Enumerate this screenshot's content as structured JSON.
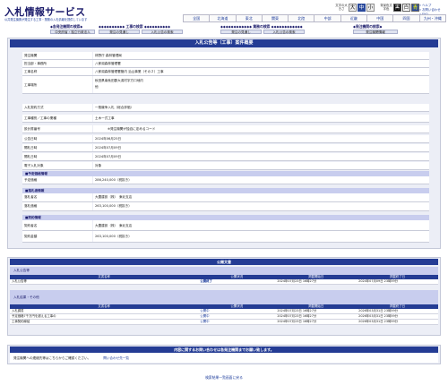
{
  "header": {
    "title": "入札情報サービス",
    "subtitle": "公共発注機関が発注する工事・業務の入札情報を提供しています",
    "font_size_label": "文字の大きさ",
    "font_sizes": [
      "大",
      "中",
      "小"
    ],
    "color_label": "背景色文字色",
    "color_options": [
      "黒",
      "白",
      "青"
    ],
    "help_links": [
      "ヘルプ",
      "お問い合わせ",
      "FAQ"
    ]
  },
  "region_tabs": [
    "全国",
    "北海道",
    "東北",
    "関東",
    "北陸",
    "中部",
    "近畿",
    "中国",
    "四国",
    "九州・沖縄"
  ],
  "categories": [
    {
      "title": "◆各発注機関の検索◆",
      "subs": [
        "中央府省・独立行政法人"
      ]
    },
    {
      "title": "◆◆◆◆◆◆◆◆◆◆ 工事の検索 ◆◆◆◆◆◆◆◆◆◆",
      "subs": [
        "発注の見通し",
        "入札公告の検索"
      ]
    },
    {
      "title": "◆◆◆◆◆◆◆◆◆◆◆◆ 業務の検索 ◆◆◆◆◆◆◆◆◆◆◆◆",
      "subs": [
        "発注の見通し",
        "入札公告の検索"
      ]
    },
    {
      "title": "◆発注機関の検索◆",
      "subs": [
        "発注機関情報"
      ]
    }
  ],
  "panel": {
    "title": "入札公告等（工事）案件概要",
    "rows": [
      {
        "label": "発注機関",
        "value": "林野庁 森林管理局"
      },
      {
        "label": "担当部・事務所",
        "value": "八郎潟森林管理署"
      },
      {
        "label": "工事名称",
        "value": "八郎潟森林管理署管内 治山事業（その２）工事"
      },
      {
        "label": "工事場所",
        "lines": [
          "秋田県南秋田郡大潟村字方口地内",
          "他"
        ]
      },
      {
        "label": "入札契約方式",
        "value": "一般競争入札（総合評価）"
      },
      {
        "label": "工事種別／工事の業種",
        "value": "土木一式工事"
      },
      {
        "label": "設計書番号",
        "value": "※発注機関が独自に定めるコード"
      },
      {
        "label": "公告日時",
        "value": "2024年06月25日"
      },
      {
        "label": "開札日時",
        "value": "2024年07月09日"
      },
      {
        "label": "開札日時",
        "value": "2024年07月09日"
      },
      {
        "label": "電子入札対象",
        "value": "対象"
      }
    ],
    "section_estimate": "■予定価格情報",
    "estimate": {
      "label": "予定価格",
      "value": "286,240,000（税抜き）"
    },
    "section_bidder": "■落札者情報",
    "bidder": [
      {
        "label": "落札者名",
        "value": "大豊建設（株）　東北支店"
      },
      {
        "label": "落札価格",
        "value": "263,100,000（税抜き）"
      }
    ],
    "section_contract": "■契約情報",
    "contract": [
      {
        "label": "契約者名",
        "value": "大豊建設（株）　東北支店"
      },
      {
        "label": "契約金額",
        "value": "263,100,000（税抜き）"
      }
    ]
  },
  "docs": {
    "title": "公開文書",
    "section1": "入札公告等",
    "headers": [
      "文書名称",
      "公開状況",
      "掲載開始日",
      "掲載終了日"
    ],
    "rows1": [
      {
        "name": "入札公告等",
        "status": "公開終了",
        "start": "2024年07月23日 16時27分",
        "end": "2024年07月09日 23時59分"
      }
    ],
    "section2": "入札結果・その他",
    "rows2": [
      {
        "name": "入札調書",
        "status": "公開中",
        "start": "2024年07月23日 16時27分",
        "end": "2026年03月31日 23時59分"
      },
      {
        "name": "予定価格7千万円を超える工事の",
        "status": "公開中",
        "start": "2024年07月23日 16時27分",
        "end": "2026年03月31日 23時59分"
      },
      {
        "name": "工事契約締結",
        "status": "公開中",
        "start": "2024年07月23日 16時27分",
        "end": "2026年03月31日 23時59分"
      }
    ]
  },
  "contact": {
    "title": "内容に関するお問い合わせは各発注機関までお願い致します。",
    "text": "発注機関への連絡先等はこちらからご確認ください。",
    "link": "問い合わせ先一覧"
  },
  "footer": {
    "back_link": "検索結果一覧画面に戻る"
  }
}
